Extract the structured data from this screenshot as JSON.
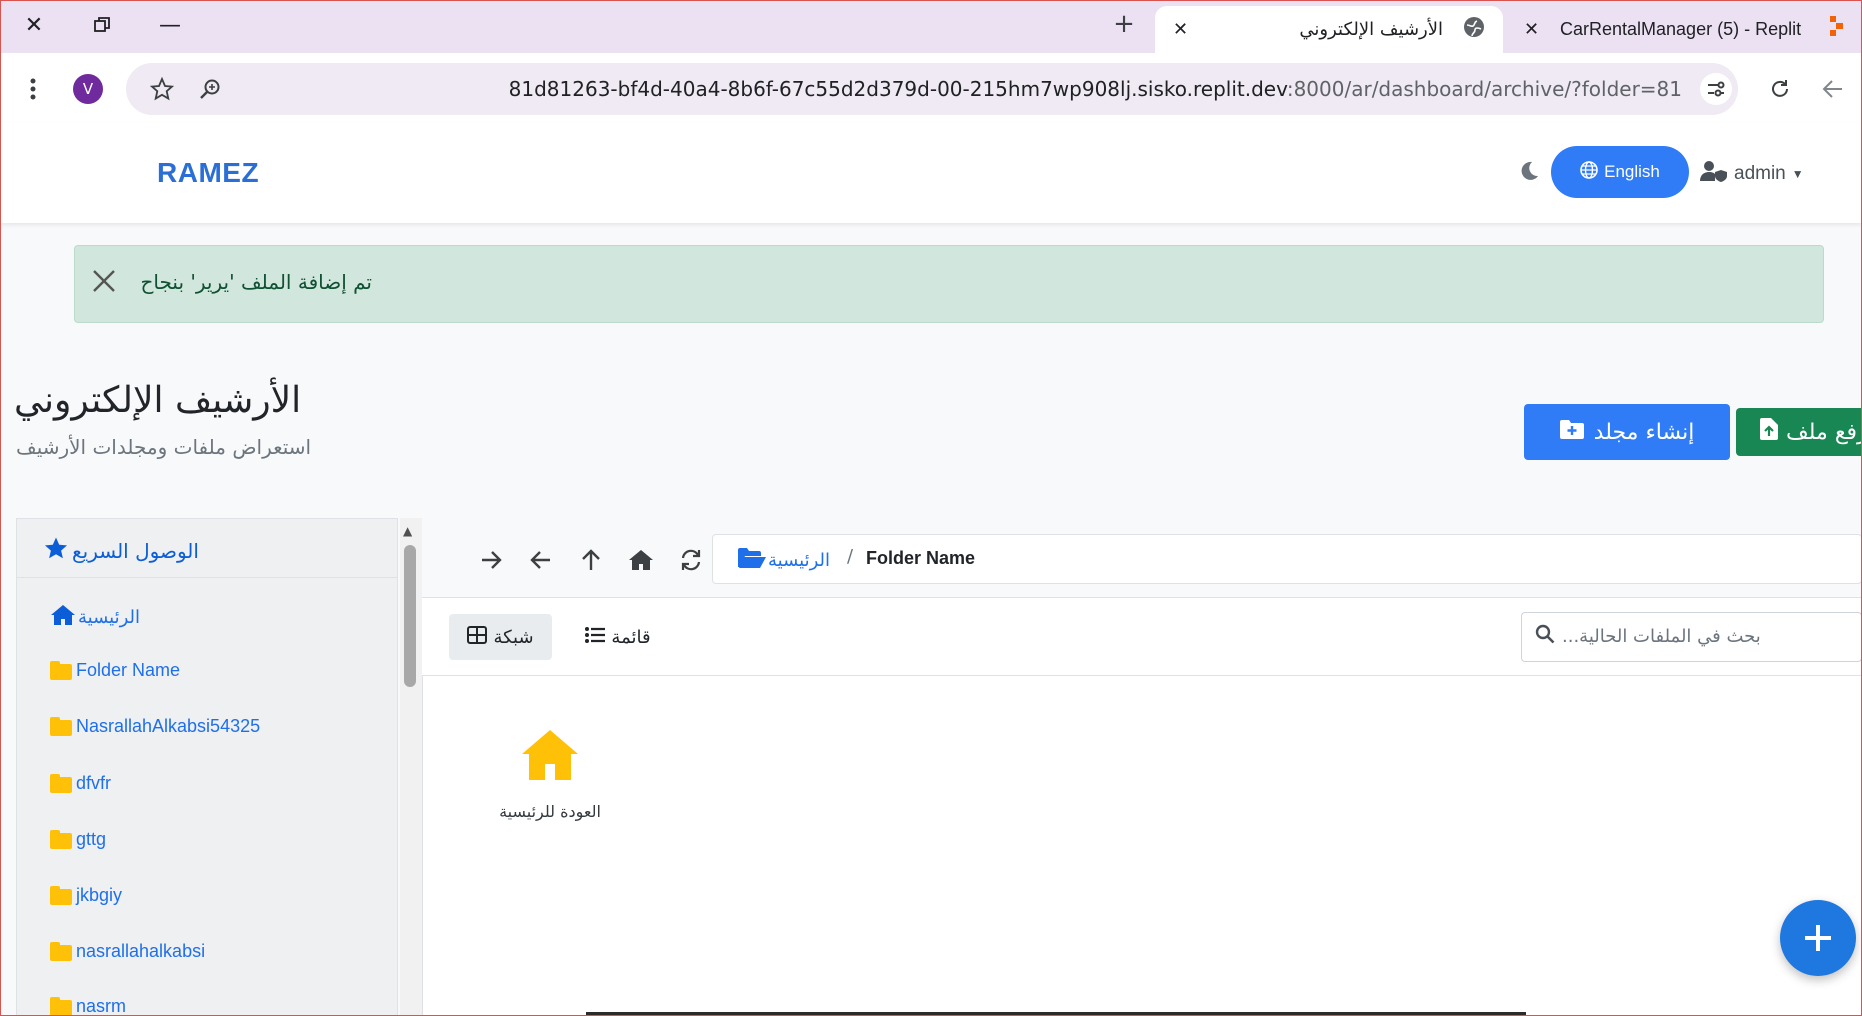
{
  "browser": {
    "tabs": [
      {
        "title": "الأرشيف الإلكتروني",
        "active": true
      },
      {
        "title": "CarRentalManager (5) - Replit",
        "active": false
      }
    ],
    "url_main": "81d81263-bf4d-40a4-8b6f-67c55d2d379d-00-215hm7wp908lj.sisko.replit.dev",
    "url_rest": ":8000/ar/dashboard/archive/?folder=81",
    "profile_initial": "V"
  },
  "navbar": {
    "brand": "RAMEZ",
    "language_button": "English",
    "user": "admin"
  },
  "alert": {
    "message": "تم إضافة الملف 'يرير' بنجاح"
  },
  "header": {
    "title": "الأرشيف الإلكتروني",
    "subtitle": "استعراض ملفات ومجلدات الأرشيف",
    "create_folder": "إنشاء مجلد",
    "upload_file": "رفع ملف"
  },
  "sidebar": {
    "title": "الوصول السريع",
    "home": "الرئيسية",
    "folders": [
      "Folder Name",
      "NasrallahAlkabsi54325",
      "dfvfr",
      "gttg",
      "jkbgiy",
      "nasrallahalkabsi",
      "nasrm"
    ]
  },
  "breadcrumb": {
    "home": "الرئيسية",
    "separator": "/",
    "current": "Folder Name"
  },
  "view": {
    "grid": "شبكة",
    "list": "قائمة",
    "search_placeholder": "بحث في الملفات الحالية..."
  },
  "items": {
    "back_home": "العودة للرئيسية"
  },
  "colors": {
    "primary": "#2f7cf6",
    "success": "#198754",
    "folder": "#ffc107",
    "alert_bg": "#d1e7dd"
  }
}
